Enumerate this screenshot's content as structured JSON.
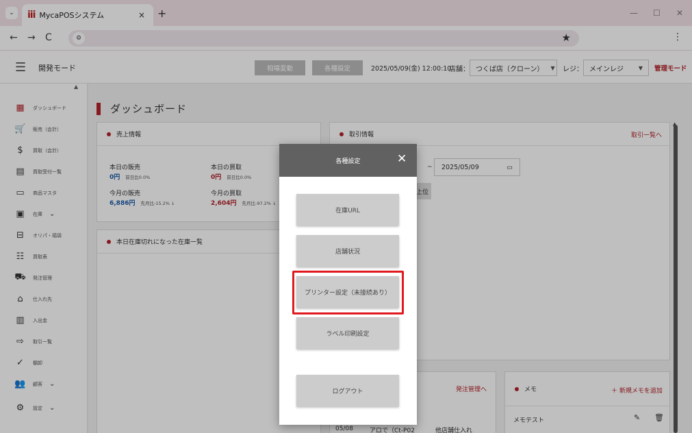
{
  "browser": {
    "tab_logo": "iii",
    "tab_title": "MycaPOSシステム",
    "tab_close": "×",
    "new_tab": "+",
    "window_minimize": "—",
    "window_maximize": "☐",
    "window_close": "✕",
    "nav_back": "←",
    "nav_forward": "→",
    "nav_reload": "C",
    "site_info": "⚙",
    "star": "★",
    "menu": "⋮",
    "tab_menu": "⌄"
  },
  "header": {
    "menu_icon": "☰",
    "mode": "開発モード",
    "market_button": "相場変動",
    "settings_button": "各種設定",
    "datetime": "2025/05/09(金) 12:00:10",
    "store_label": "店舗：",
    "store_value": "つくば店（クローン）",
    "register_label": "レジ：",
    "register_value": "メインレジ",
    "admin_mode": "管理モード",
    "caret": "▼"
  },
  "sidebar": {
    "scroll_up": "▲",
    "items": [
      {
        "label": "ダッシュボード",
        "icon": "dashboard-icon",
        "glyph": "▦"
      },
      {
        "label": "販売（会計）",
        "icon": "cart-icon",
        "glyph": "🛒"
      },
      {
        "label": "買取（会計）",
        "icon": "dollar-icon",
        "glyph": "$"
      },
      {
        "label": "買取受付一覧",
        "icon": "clipboard-icon",
        "glyph": "▤"
      },
      {
        "label": "商品マスタ",
        "icon": "store-icon",
        "glyph": "▭"
      },
      {
        "label": "在庫",
        "icon": "inventory-icon",
        "glyph": "▣",
        "chev": "⌄"
      },
      {
        "label": "オリパ・福袋",
        "icon": "gift-icon",
        "glyph": "⊟"
      },
      {
        "label": "買取表",
        "icon": "list-icon",
        "glyph": "☷"
      },
      {
        "label": "発注管理",
        "icon": "truck-icon",
        "glyph": "⛟"
      },
      {
        "label": "仕入れ先",
        "icon": "supplier-icon",
        "glyph": "⌂"
      },
      {
        "label": "入出金",
        "icon": "register-icon",
        "glyph": "▥"
      },
      {
        "label": "取引一覧",
        "icon": "transfer-icon",
        "glyph": "⇨"
      },
      {
        "label": "棚卸",
        "icon": "check-clipboard-icon",
        "glyph": "✓"
      },
      {
        "label": "顧客",
        "icon": "people-icon",
        "glyph": "👥",
        "chev": "⌄"
      },
      {
        "label": "設定",
        "icon": "gear-icon",
        "glyph": "⚙",
        "chev": "⌄"
      }
    ]
  },
  "main": {
    "page_title": "ダッシュボード",
    "sales_card": {
      "title": "売上情報",
      "today_sales_label": "本日の販売",
      "today_sales_value": "0円",
      "today_sales_note": "前日比0.0%",
      "today_buy_label": "本日の買取",
      "today_buy_value": "0円",
      "today_buy_note": "前日比0.0%",
      "month_sales_label": "今月の販売",
      "month_sales_value": "6,886円",
      "month_sales_note": "先月比-15.2% ↓",
      "month_buy_label": "今月の買取",
      "month_buy_value": "2,604円",
      "month_buy_note": "先月比-97.2% ↓"
    },
    "stockout_card": {
      "title": "本日在庫切れになった在庫一覧"
    },
    "transaction_card": {
      "title": "取引情報",
      "link": "取引一覧へ",
      "date_separator": "~",
      "date_to": "2025/05/09",
      "calendar": "▭",
      "rank_button": "上位"
    },
    "order_card": {
      "link": "発注管理へ",
      "row_date": "05/08",
      "row_text": "アロで（Ct-P02",
      "row_type": "他店舗仕入れ"
    },
    "memo_card": {
      "title": "メモ",
      "add_link": "＋ 新規メモを追加",
      "memo_item": "メモテスト",
      "edit": "✎",
      "delete": "🗑"
    },
    "scroll_up": "▲"
  },
  "modal": {
    "title": "各種設定",
    "close": "✕",
    "buttons": {
      "stock_url": "在庫URL",
      "store_status": "店舗状況",
      "printer": "プリンター設定（未接続あり）",
      "label_print": "ラベル印刷設定",
      "logout": "ログアウト"
    }
  },
  "colors": {
    "accent": "#b4232a",
    "highlight": "#e0191e",
    "modal_header": "#616161"
  }
}
